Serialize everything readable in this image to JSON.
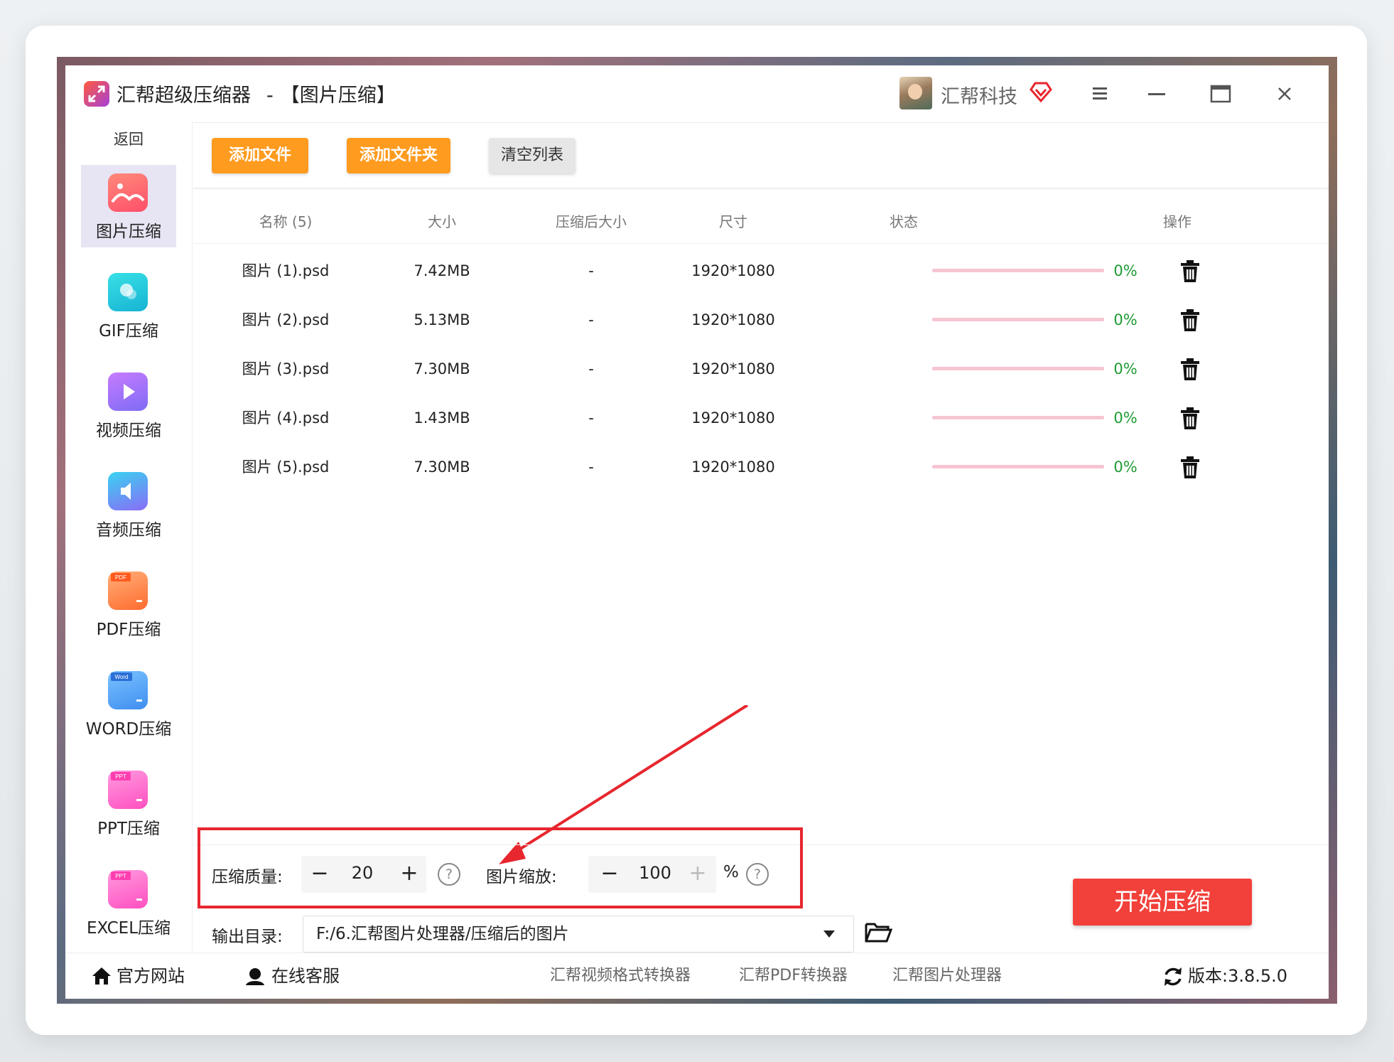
{
  "app": {
    "title": "汇帮超级压缩器",
    "title_sep": "-",
    "subtitle": "【图片压缩】",
    "user_name": "汇帮科技"
  },
  "sidebar": {
    "back_label": "返回",
    "items": [
      {
        "label": "图片压缩",
        "icon": "image-compress-icon",
        "color": "#ff5b6e",
        "active": true
      },
      {
        "label": "GIF压缩",
        "icon": "gif-compress-icon",
        "color": "#1fc8d8",
        "active": false
      },
      {
        "label": "视频压缩",
        "icon": "video-compress-icon",
        "color": "#b45cf0",
        "active": false
      },
      {
        "label": "音频压缩",
        "icon": "audio-compress-icon",
        "color": "#4f8cf7",
        "active": false
      },
      {
        "label": "PDF压缩",
        "icon": "pdf-compress-icon",
        "color": "#ff7a2e",
        "badge": "PDF",
        "active": false
      },
      {
        "label": "WORD压缩",
        "icon": "word-compress-icon",
        "color": "#3e8ef0",
        "badge": "Word",
        "active": false
      },
      {
        "label": "PPT压缩",
        "icon": "ppt-compress-icon",
        "color": "#ff5fc6",
        "badge": "PPT",
        "active": false
      },
      {
        "label": "EXCEL压缩",
        "icon": "excel-compress-icon",
        "color": "#ff5fc6",
        "badge": "PPT",
        "active": false
      }
    ]
  },
  "toolbar": {
    "add_file": "添加文件",
    "add_folder": "添加文件夹",
    "clear_list": "清空列表"
  },
  "table": {
    "headers": [
      "名称 (5)",
      "大小",
      "压缩后大小",
      "尺寸",
      "状态",
      "操作"
    ],
    "rows": [
      {
        "name": "图片 (1).psd",
        "size": "7.42MB",
        "compressed": "-",
        "dimension": "1920*1080",
        "progress": 0,
        "status": "0%"
      },
      {
        "name": "图片 (2).psd",
        "size": "5.13MB",
        "compressed": "-",
        "dimension": "1920*1080",
        "progress": 0,
        "status": "0%"
      },
      {
        "name": "图片 (3).psd",
        "size": "7.30MB",
        "compressed": "-",
        "dimension": "1920*1080",
        "progress": 0,
        "status": "0%"
      },
      {
        "name": "图片 (4).psd",
        "size": "1.43MB",
        "compressed": "-",
        "dimension": "1920*1080",
        "progress": 0,
        "status": "0%"
      },
      {
        "name": "图片 (5).psd",
        "size": "7.30MB",
        "compressed": "-",
        "dimension": "1920*1080",
        "progress": 0,
        "status": "0%"
      }
    ]
  },
  "settings": {
    "quality_label": "压缩质量:",
    "quality_value": "20",
    "scale_label": "图片缩放:",
    "scale_value": "100",
    "scale_unit": "%",
    "minus": "−",
    "plus": "+",
    "help": "?",
    "output_label": "输出目录:",
    "output_path": "F:/6.汇帮图片处理器/压缩后的图片",
    "start_button": "开始压缩"
  },
  "footer": {
    "website": "官方网站",
    "support": "在线客服",
    "links": [
      "汇帮视频格式转换器",
      "汇帮PDF转换器",
      "汇帮图片处理器"
    ],
    "version_label": "版本:",
    "version": "3.8.5.0"
  },
  "colors": {
    "accent_orange": "#ff9b1f",
    "start_red": "#f2403a",
    "progress_track": "#f7c5d2",
    "status_green": "#1e9b35",
    "highlight_box": "#e7262e",
    "annotation_arrow": "#e7262e"
  }
}
